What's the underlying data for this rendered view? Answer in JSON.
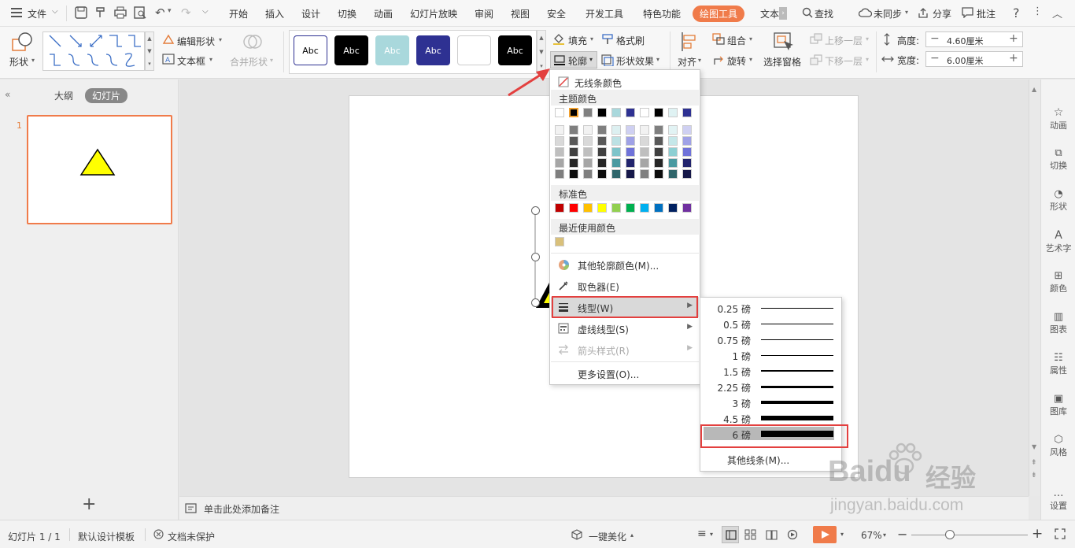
{
  "menubar": {
    "file_label": "文件",
    "tabs": [
      "开始",
      "插入",
      "设计",
      "切换",
      "动画",
      "幻灯片放映",
      "审阅",
      "视图",
      "安全",
      "开发工具",
      "特色功能",
      "绘图工具",
      "文本"
    ],
    "active_tab": "绘图工具",
    "search_label": "查找",
    "sync_label": "未同步",
    "share_label": "分享",
    "comment_label": "批注"
  },
  "ribbon": {
    "shape_label": "形状",
    "edit_shape_label": "编辑形状",
    "textbox_label": "文本框",
    "merge_shape_label": "合并形状",
    "style_sample_text": "Abc",
    "styles": [
      {
        "bg": "#ffffff",
        "fg": "#000000",
        "border": "#2e3192"
      },
      {
        "bg": "#000000",
        "fg": "#ffffff",
        "border": "#000000"
      },
      {
        "bg": "#a9d8dc",
        "fg": "#ffffff",
        "border": "#a9d8dc"
      },
      {
        "bg": "#2e3192",
        "fg": "#ffffff",
        "border": "#2e3192"
      },
      {
        "bg": "#ffffff",
        "fg": "#ffffff",
        "border": "#cccccc"
      },
      {
        "bg": "#000000",
        "fg": "#ffffff",
        "border": "#000000"
      }
    ],
    "fill_label": "填充",
    "format_brush_label": "格式刷",
    "outline_label": "轮廓",
    "shape_effect_label": "形状效果",
    "align_label": "对齐",
    "group_label": "组合",
    "rotate_label": "旋转",
    "selection_pane_label": "选择窗格",
    "bring_forward_label": "上移一层",
    "send_backward_label": "下移一层",
    "height_label": "高度:",
    "height_value": "4.60厘米",
    "width_label": "宽度:",
    "width_value": "6.00厘米"
  },
  "left_panel": {
    "outline_tab": "大纲",
    "slides_tab": "幻灯片",
    "slide_number": "1",
    "add_label": "+"
  },
  "notes_placeholder": "单击此处添加备注",
  "right_bar": [
    "动画",
    "切换",
    "形状",
    "艺术字",
    "颜色",
    "图表",
    "属性",
    "图库",
    "风格",
    "设置"
  ],
  "outline_dropdown": {
    "no_outline_label": "无线条颜色",
    "theme_colors_label": "主题颜色",
    "theme_top_row": [
      "#ffffff",
      "#000000",
      "#808080",
      "#000000",
      "#a9d8dc",
      "#2e3192",
      "#ffffff",
      "#000000",
      "#dff2f3",
      "#2e3192"
    ],
    "theme_shades": [
      [
        "#f2f2f2",
        "#7f7f7f",
        "#f2f2f2",
        "#7f7f7f",
        "#ddf0f1",
        "#cfd0f2",
        "#f2f2f2",
        "#7f7f7f",
        "#e2f3f4",
        "#cfd0f2"
      ],
      [
        "#d9d9d9",
        "#595959",
        "#d9d9d9",
        "#595959",
        "#bce1e4",
        "#9fa1e6",
        "#d9d9d9",
        "#595959",
        "#c5e7e9",
        "#9fa1e6"
      ],
      [
        "#bfbfbf",
        "#404040",
        "#bfbfbf",
        "#404040",
        "#7ec4ca",
        "#6f72d9",
        "#bfbfbf",
        "#404040",
        "#8dcfd3",
        "#6f72d9"
      ],
      [
        "#a6a6a6",
        "#262626",
        "#a6a6a6",
        "#262626",
        "#4a9aa1",
        "#22246d",
        "#a6a6a6",
        "#262626",
        "#4a9aa1",
        "#22246d"
      ],
      [
        "#7f7f7f",
        "#0d0d0d",
        "#7f7f7f",
        "#0d0d0d",
        "#30666b",
        "#161849",
        "#7f7f7f",
        "#0d0d0d",
        "#30666b",
        "#161849"
      ]
    ],
    "standard_colors_label": "标准色",
    "standard_colors": [
      "#c00000",
      "#ff0000",
      "#ffc000",
      "#ffff00",
      "#92d050",
      "#00b050",
      "#00b0f0",
      "#0070c0",
      "#002060",
      "#7030a0"
    ],
    "recent_colors_label": "最近使用颜色",
    "recent_colors": [
      "#d9c07a"
    ],
    "more_colors_label": "其他轮廓颜色(M)...",
    "eyedropper_label": "取色器(E)",
    "line_style_label": "线型(W)",
    "dash_style_label": "虚线线型(S)",
    "arrow_style_label": "箭头样式(R)",
    "more_settings_label": "更多设置(O)..."
  },
  "line_weight_submenu": {
    "items": [
      {
        "label": "0.25 磅",
        "weight": 0.25
      },
      {
        "label": "0.5 磅",
        "weight": 0.5
      },
      {
        "label": "0.75 磅",
        "weight": 0.75
      },
      {
        "label": "1 磅",
        "weight": 1
      },
      {
        "label": "1.5 磅",
        "weight": 1.5
      },
      {
        "label": "2.25 磅",
        "weight": 2.25
      },
      {
        "label": "3 磅",
        "weight": 3
      },
      {
        "label": "4.5 磅",
        "weight": 4.5
      },
      {
        "label": "6 磅",
        "weight": 6
      }
    ],
    "selected": "6 磅",
    "more_lines_label": "其他线条(M)..."
  },
  "status_bar": {
    "slide_info": "幻灯片 1 / 1",
    "template": "默认设计模板",
    "protection": "文档未保护",
    "beautify": "一键美化",
    "zoom": "67%"
  },
  "watermark": {
    "brand": "Baidu",
    "brand_cn": "经验",
    "url": "jingyan.baidu.com"
  },
  "colors": {
    "accent": "#f07b4a",
    "highlight_red": "#e3403f",
    "shape_fill": "#ffff00"
  }
}
